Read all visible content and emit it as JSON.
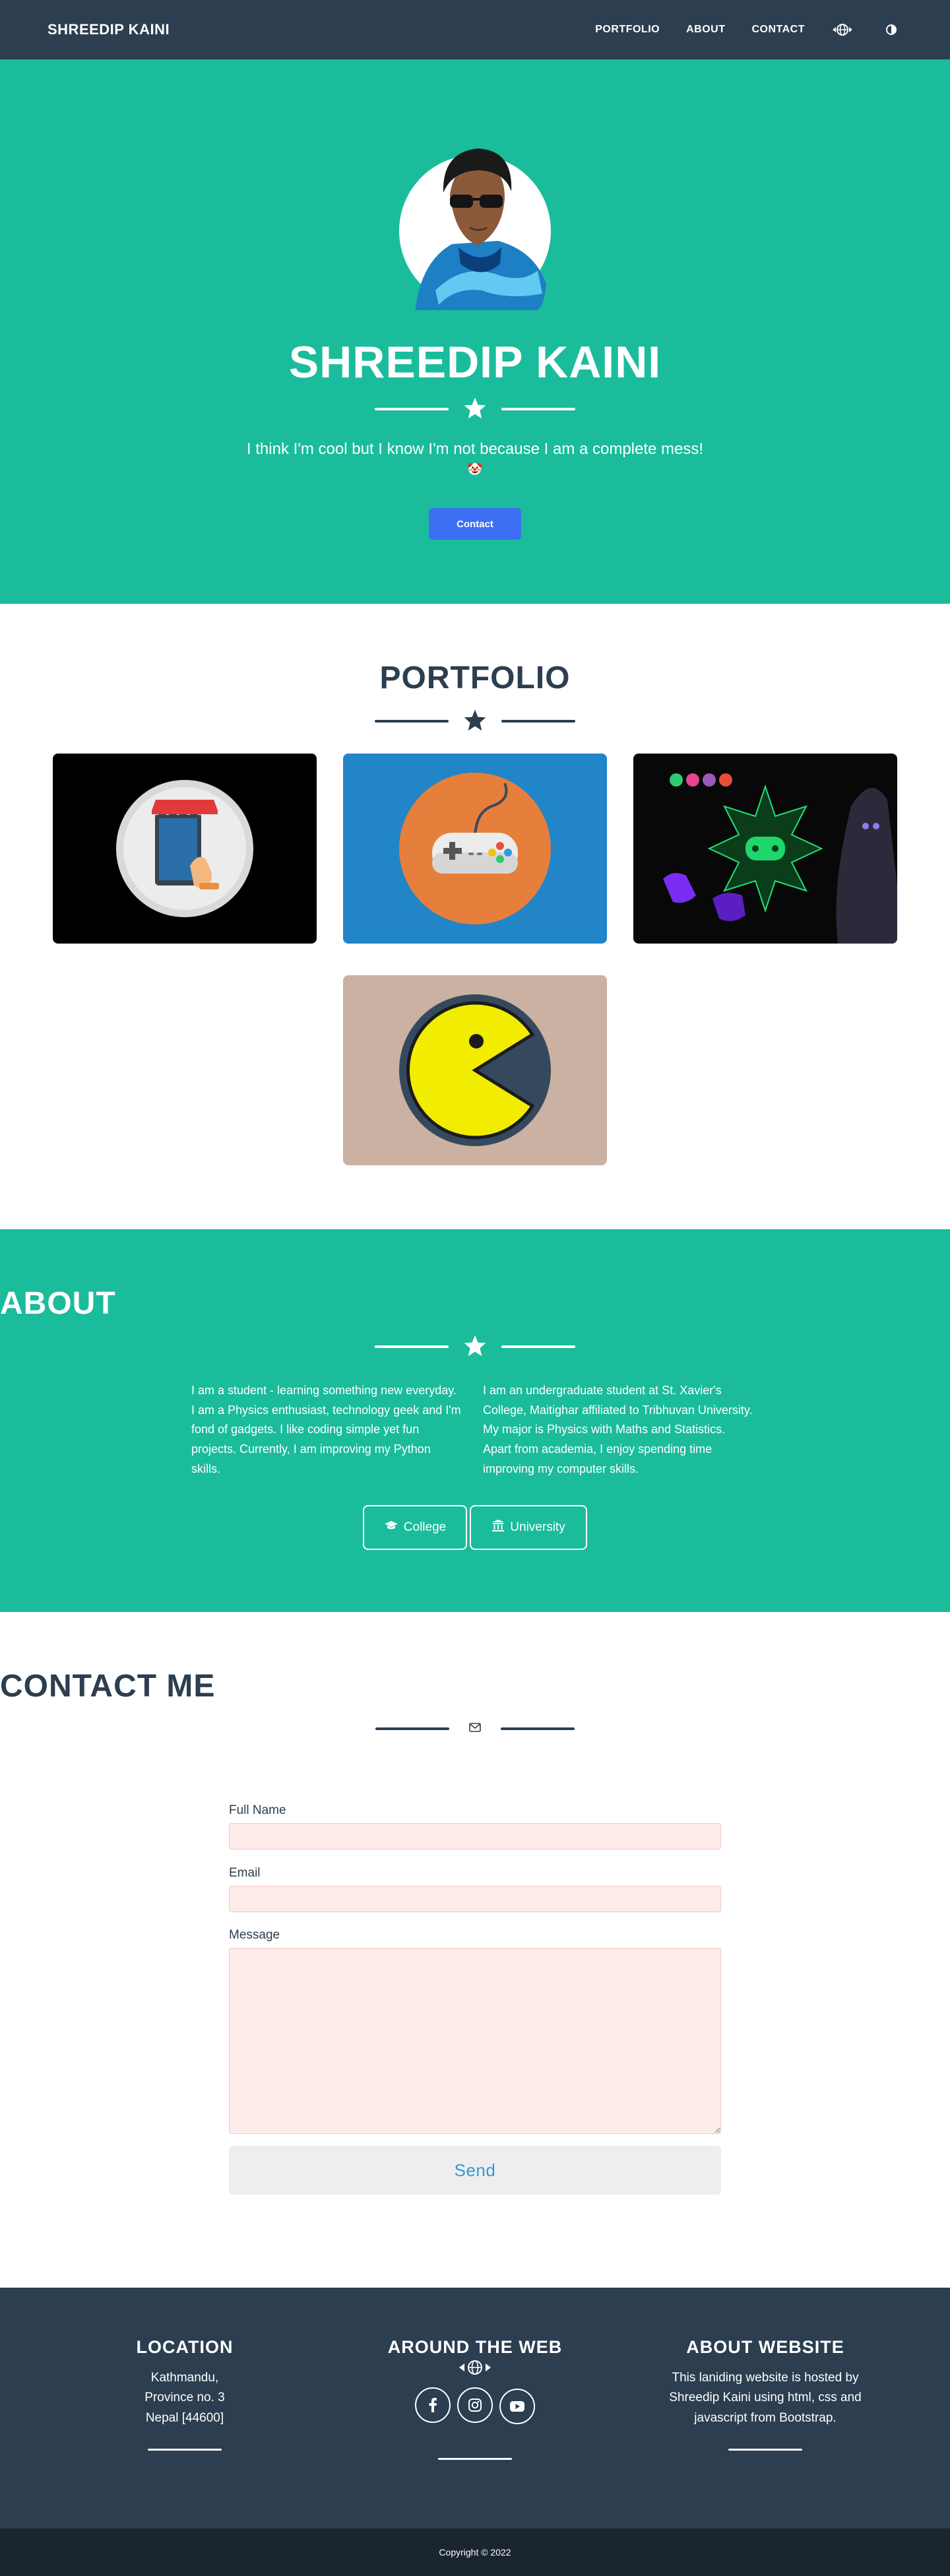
{
  "nav": {
    "brand": "SHREEDIP KAINI",
    "links": [
      "PORTFOLIO",
      "ABOUT",
      "CONTACT"
    ],
    "icons": [
      "globe-icon",
      "theme-toggle-icon"
    ]
  },
  "hero": {
    "title": "SHREEDIP KAINI",
    "subtitle": "I think I'm cool but I know I'm not because I am a complete mess!",
    "emoji": "🤡",
    "button": "Contact"
  },
  "portfolio": {
    "title": "PORTFOLIO",
    "items": [
      "shop-app",
      "game-controller",
      "gaming-wallpaper",
      "pacman"
    ]
  },
  "about": {
    "title": "ABOUT",
    "left": "I am a student - learning something new everyday. I am a Physics enthusiast, technology geek and I'm fond of gadgets. I like coding simple yet fun projects. Currently, I am improving my Python skills.",
    "right": "I am an undergraduate student at St. Xavier's College, Maitighar affiliated to Tribhuvan University. My major is Physics with Maths and Statistics. Apart from academia, I enjoy spending time improving my computer skills.",
    "buttons": [
      "College",
      "University"
    ]
  },
  "contact": {
    "title": "CONTACT ME",
    "labels": {
      "name": "Full Name",
      "email": "Email",
      "message": "Message"
    },
    "values": {
      "name": "",
      "email": "",
      "message": ""
    },
    "send": "Send"
  },
  "footer": {
    "location_head": "LOCATION",
    "location_lines": [
      "Kathmandu,",
      "Province no. 3",
      "Nepal [44600]"
    ],
    "web_head": "AROUND THE WEB",
    "about_head": "ABOUT WEBSITE",
    "about_text": "This laniding website is hosted by Shreedip Kaini using html, css and javascript from Bootstrap.",
    "copyright": "Copyright © 2022"
  },
  "colors": {
    "teal": "#1abc9c",
    "navy": "#2c3e50",
    "dark": "#1a252f",
    "button_blue": "#3d6ff4"
  }
}
